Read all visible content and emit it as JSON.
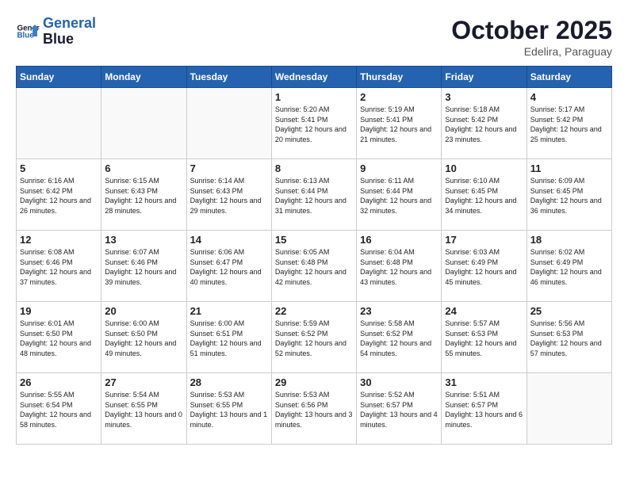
{
  "header": {
    "logo_line1": "General",
    "logo_line2": "Blue",
    "month": "October 2025",
    "location": "Edelira, Paraguay"
  },
  "days_of_week": [
    "Sunday",
    "Monday",
    "Tuesday",
    "Wednesday",
    "Thursday",
    "Friday",
    "Saturday"
  ],
  "weeks": [
    [
      {
        "day": "",
        "empty": true
      },
      {
        "day": "",
        "empty": true
      },
      {
        "day": "",
        "empty": true
      },
      {
        "day": "1",
        "sunrise": "5:20 AM",
        "sunset": "5:41 PM",
        "daylight": "12 hours and 20 minutes."
      },
      {
        "day": "2",
        "sunrise": "5:19 AM",
        "sunset": "5:41 PM",
        "daylight": "12 hours and 21 minutes."
      },
      {
        "day": "3",
        "sunrise": "5:18 AM",
        "sunset": "5:42 PM",
        "daylight": "12 hours and 23 minutes."
      },
      {
        "day": "4",
        "sunrise": "5:17 AM",
        "sunset": "5:42 PM",
        "daylight": "12 hours and 25 minutes."
      }
    ],
    [
      {
        "day": "5",
        "sunrise": "6:16 AM",
        "sunset": "6:42 PM",
        "daylight": "12 hours and 26 minutes."
      },
      {
        "day": "6",
        "sunrise": "6:15 AM",
        "sunset": "6:43 PM",
        "daylight": "12 hours and 28 minutes."
      },
      {
        "day": "7",
        "sunrise": "6:14 AM",
        "sunset": "6:43 PM",
        "daylight": "12 hours and 29 minutes."
      },
      {
        "day": "8",
        "sunrise": "6:13 AM",
        "sunset": "6:44 PM",
        "daylight": "12 hours and 31 minutes."
      },
      {
        "day": "9",
        "sunrise": "6:11 AM",
        "sunset": "6:44 PM",
        "daylight": "12 hours and 32 minutes."
      },
      {
        "day": "10",
        "sunrise": "6:10 AM",
        "sunset": "6:45 PM",
        "daylight": "12 hours and 34 minutes."
      },
      {
        "day": "11",
        "sunrise": "6:09 AM",
        "sunset": "6:45 PM",
        "daylight": "12 hours and 36 minutes."
      }
    ],
    [
      {
        "day": "12",
        "sunrise": "6:08 AM",
        "sunset": "6:46 PM",
        "daylight": "12 hours and 37 minutes."
      },
      {
        "day": "13",
        "sunrise": "6:07 AM",
        "sunset": "6:46 PM",
        "daylight": "12 hours and 39 minutes."
      },
      {
        "day": "14",
        "sunrise": "6:06 AM",
        "sunset": "6:47 PM",
        "daylight": "12 hours and 40 minutes."
      },
      {
        "day": "15",
        "sunrise": "6:05 AM",
        "sunset": "6:48 PM",
        "daylight": "12 hours and 42 minutes."
      },
      {
        "day": "16",
        "sunrise": "6:04 AM",
        "sunset": "6:48 PM",
        "daylight": "12 hours and 43 minutes."
      },
      {
        "day": "17",
        "sunrise": "6:03 AM",
        "sunset": "6:49 PM",
        "daylight": "12 hours and 45 minutes."
      },
      {
        "day": "18",
        "sunrise": "6:02 AM",
        "sunset": "6:49 PM",
        "daylight": "12 hours and 46 minutes."
      }
    ],
    [
      {
        "day": "19",
        "sunrise": "6:01 AM",
        "sunset": "6:50 PM",
        "daylight": "12 hours and 48 minutes."
      },
      {
        "day": "20",
        "sunrise": "6:00 AM",
        "sunset": "6:50 PM",
        "daylight": "12 hours and 49 minutes."
      },
      {
        "day": "21",
        "sunrise": "6:00 AM",
        "sunset": "6:51 PM",
        "daylight": "12 hours and 51 minutes."
      },
      {
        "day": "22",
        "sunrise": "5:59 AM",
        "sunset": "6:52 PM",
        "daylight": "12 hours and 52 minutes."
      },
      {
        "day": "23",
        "sunrise": "5:58 AM",
        "sunset": "6:52 PM",
        "daylight": "12 hours and 54 minutes."
      },
      {
        "day": "24",
        "sunrise": "5:57 AM",
        "sunset": "6:53 PM",
        "daylight": "12 hours and 55 minutes."
      },
      {
        "day": "25",
        "sunrise": "5:56 AM",
        "sunset": "6:53 PM",
        "daylight": "12 hours and 57 minutes."
      }
    ],
    [
      {
        "day": "26",
        "sunrise": "5:55 AM",
        "sunset": "6:54 PM",
        "daylight": "12 hours and 58 minutes."
      },
      {
        "day": "27",
        "sunrise": "5:54 AM",
        "sunset": "6:55 PM",
        "daylight": "13 hours and 0 minutes."
      },
      {
        "day": "28",
        "sunrise": "5:53 AM",
        "sunset": "6:55 PM",
        "daylight": "13 hours and 1 minute."
      },
      {
        "day": "29",
        "sunrise": "5:53 AM",
        "sunset": "6:56 PM",
        "daylight": "13 hours and 3 minutes."
      },
      {
        "day": "30",
        "sunrise": "5:52 AM",
        "sunset": "6:57 PM",
        "daylight": "13 hours and 4 minutes."
      },
      {
        "day": "31",
        "sunrise": "5:51 AM",
        "sunset": "6:57 PM",
        "daylight": "13 hours and 6 minutes."
      },
      {
        "day": "",
        "empty": true
      }
    ]
  ]
}
